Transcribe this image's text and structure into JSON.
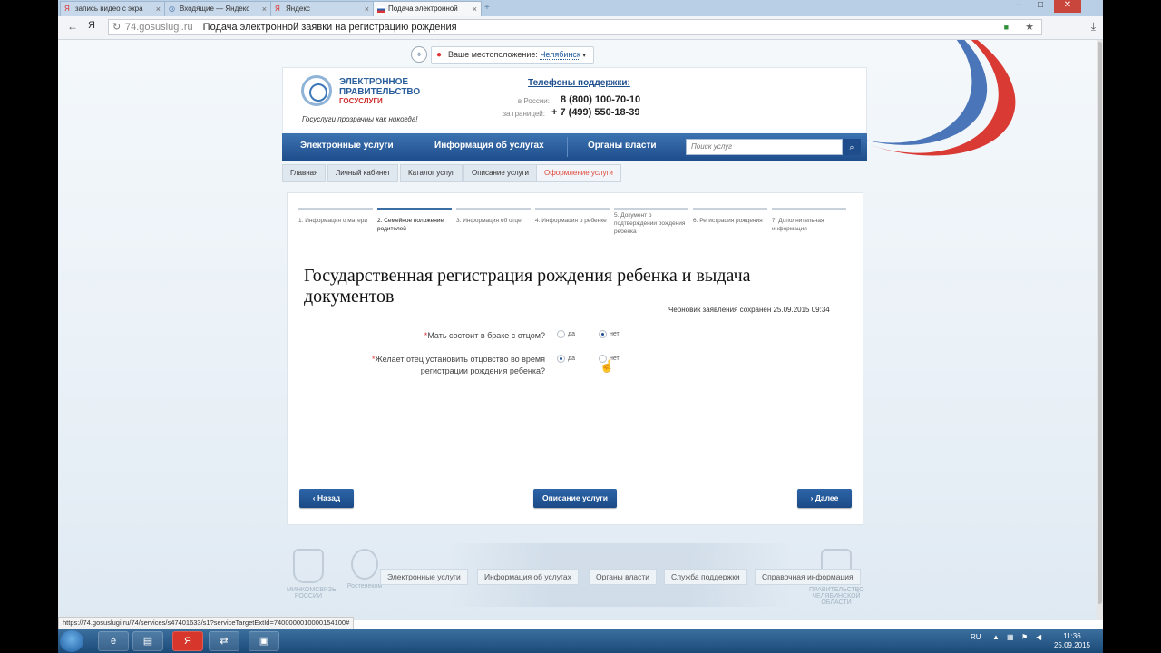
{
  "browser": {
    "tabs": [
      {
        "label": "запись видео с экра",
        "icon": "yandex-icon"
      },
      {
        "label": "Входящие — Яндекс",
        "icon": "mail-icon"
      },
      {
        "label": "Яндекс",
        "icon": "yandex-icon"
      },
      {
        "label": "Подача электронной",
        "icon": "flag-icon",
        "active": true
      }
    ],
    "close_tab": "×",
    "new_tab": "+",
    "window_controls": {
      "minimize": "–",
      "maximize": "□",
      "close": "✕"
    },
    "url_domain": "74.gosuslugi.ru",
    "page_title": "Подача электронной заявки на регистрацию рождения",
    "yandex_glyph": "Я",
    "status_url": "https://74.gosuslugi.ru/74/services/s47401633/s1?serviceTargetExtId=7400000010000154100#"
  },
  "site": {
    "location_label": "Ваше местоположение:",
    "location_city": "Челябинск",
    "logo_line1": "ЭЛЕКТРОННОЕ ПРАВИТЕЛЬСТВО",
    "logo_line2": "ГОСУСЛУГИ",
    "slogan": "Госуслуги прозрачны как никогда!",
    "phones_title": "Телефоны поддержки",
    "phone_ru_label": "в России:",
    "phone_ru": "8 (800) 100-70-10",
    "phone_abroad_label": "за границей:",
    "phone_abroad": "+ 7 (499) 550-18-39",
    "nav": [
      "Электронные услуги",
      "Информация об услугах",
      "Органы власти"
    ],
    "search_placeholder": "Поиск услуг",
    "breadcrumbs": [
      "Главная",
      "Личный кабинет",
      "Каталог услуг",
      "Описание услуги",
      "Оформление услуги"
    ]
  },
  "form": {
    "steps": [
      "1. Информация о матери",
      "2. Семейное положение родителей",
      "3. Информация об отце",
      "4. Информация о ребенке",
      "5. Документ о подтверждении рождения ребенка",
      "6. Регистрация рождения",
      "7. Дополнительная информация"
    ],
    "active_step": 2,
    "title": "Государственная регистрация рождения ребенка и выдача документов",
    "draft_saved": "Черновик заявления сохранен 25.09.2015 09:34",
    "q1": "Мать состоит в браке с отцом?",
    "q2": "Желает отец установить отцовство во время регистрации рождения ребенка?",
    "required_mark": "*",
    "yes": "да",
    "no": "нет",
    "q1_answer": "нет",
    "q2_answer": "да",
    "back_button": "Назад",
    "service_button": "Описание услуги",
    "next_button": "Далее"
  },
  "footer": {
    "emblem1": "МИНКОМСВЯЗЬ РОССИИ",
    "emblem2": "Ростелеком",
    "emblem3": "ПРАВИТЕЛЬСТВО ЧЕЛЯБИНСКОЙ ОБЛАСТИ",
    "links": [
      "Электронные услуги",
      "Информация об услугах",
      "Органы власти",
      "Служба поддержки",
      "Справочная информация"
    ]
  },
  "taskbar": {
    "lang": "RU",
    "time": "11:36",
    "date": "25.09.2015"
  }
}
